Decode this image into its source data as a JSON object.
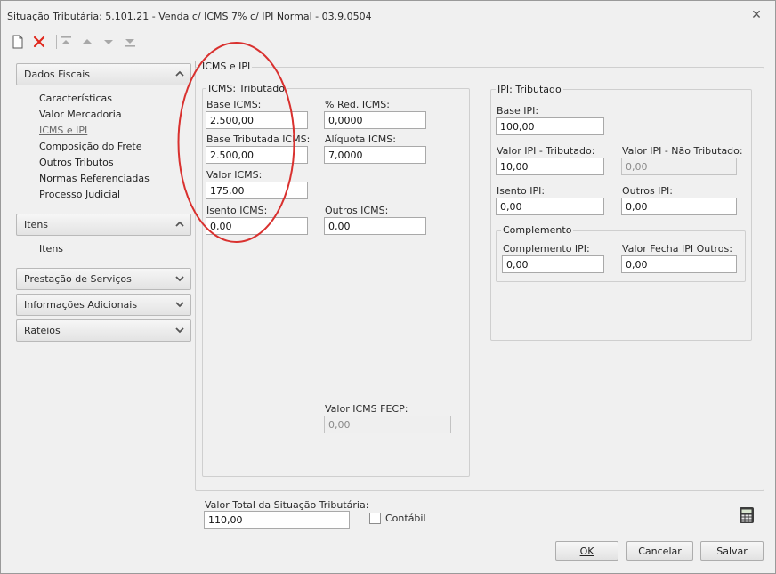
{
  "window": {
    "title": "Situação Tributária: 5.101.21 - Venda c/ ICMS 7% c/ IPI Normal - 03.9.0504",
    "close_glyph": "✕"
  },
  "toolbar": {
    "new_icon": "new-document-icon",
    "delete_icon": "delete-x-icon",
    "first_icon": "move-first-icon",
    "up_icon": "move-up-icon",
    "down_icon": "move-down-icon",
    "last_icon": "move-last-icon"
  },
  "nav": {
    "dados_fiscais": {
      "label": "Dados Fiscais",
      "items": [
        "Características",
        "Valor Mercadoria",
        "ICMS e IPI",
        "Composição do Frete",
        "Outros Tributos",
        "Normas Referenciadas",
        "Processo Judicial"
      ],
      "active_index": 2
    },
    "itens": {
      "label": "Itens",
      "items": [
        "Itens"
      ]
    },
    "prestacao": {
      "label": "Prestação de Serviços"
    },
    "informacoes": {
      "label": "Informações Adicionais"
    },
    "rateios": {
      "label": "Rateios"
    }
  },
  "main": {
    "section_title": "ICMS e IPI",
    "icms": {
      "title": "ICMS: Tributado",
      "base_icms": {
        "label": "Base ICMS:",
        "value": "2.500,00"
      },
      "red_icms": {
        "label": "% Red. ICMS:",
        "value": "0,0000"
      },
      "base_tributada": {
        "label": "Base Tributada ICMS:",
        "value": "2.500,00"
      },
      "aliquota": {
        "label": "Alíquota ICMS:",
        "value": "7,0000"
      },
      "valor_icms": {
        "label": "Valor ICMS:",
        "value": "175,00"
      },
      "isento": {
        "label": "Isento ICMS:",
        "value": "0,00"
      },
      "outros": {
        "label": "Outros ICMS:",
        "value": "0,00"
      },
      "fecp": {
        "label": "Valor ICMS FECP:",
        "value": "0,00"
      }
    },
    "ipi": {
      "title": "IPI: Tributado",
      "base_ipi": {
        "label": "Base IPI:",
        "value": "100,00"
      },
      "valor_trib": {
        "label": "Valor IPI - Tributado:",
        "value": "10,00"
      },
      "valor_nao_trib": {
        "label": "Valor IPI - Não Tributado:",
        "value": "0,00"
      },
      "isento": {
        "label": "Isento IPI:",
        "value": "0,00"
      },
      "outros": {
        "label": "Outros IPI:",
        "value": "0,00"
      },
      "complemento": {
        "title": "Complemento",
        "comp_ipi": {
          "label": "Complemento IPI:",
          "value": "0,00"
        },
        "fecha_outros": {
          "label": "Valor Fecha IPI Outros:",
          "value": "0,00"
        }
      }
    }
  },
  "footer": {
    "total_label": "Valor Total da Situação Tributária:",
    "total_value": "110,00",
    "contabil_label": "Contábil",
    "contabil_checked": false,
    "calculator_icon": "calculator-icon",
    "ok_label": "OK",
    "cancel_label": "Cancelar",
    "save_label": "Salvar"
  },
  "colors": {
    "annotation": "#d9312f",
    "delete": "#e0281d",
    "window_bg": "#f0f0f0"
  }
}
